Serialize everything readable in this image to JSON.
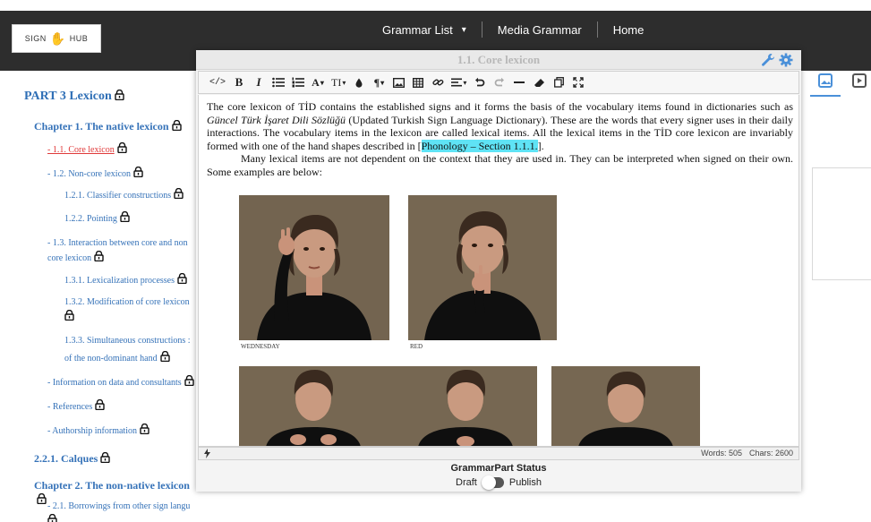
{
  "logo": {
    "left_text": "SIGN",
    "right_text": "HUB"
  },
  "nav": {
    "grammar_list": "Grammar List",
    "dropdown_caret": "▾",
    "media_grammar": "Media Grammar",
    "home": "Home"
  },
  "sidebar": {
    "part": "PART 3 Lexicon",
    "chapter1": "Chapter 1. The native lexicon",
    "item_1_1": "- 1.1. Core lexicon",
    "item_1_2": "- 1.2. Non-core lexicon",
    "item_1_2_1": "1.2.1. Classifier constructions",
    "item_1_2_2": "1.2.2. Pointing",
    "item_1_3_a": "- 1.3. Interaction between core and non",
    "item_1_3_b": "core lexicon",
    "item_1_3_1": "1.3.1. Lexicalization processes",
    "item_1_3_2": "1.3.2. Modification of core lexicon",
    "item_1_3_3_a": "1.3.3. Simultaneous constructions :",
    "item_1_3_3_b": "of the non-dominant hand",
    "info": "- Information on data and consultants",
    "references": "- References",
    "authorship": "- Authorship information",
    "calques": "2.2.1. Calques",
    "chapter2": "Chapter 2. The non-native lexicon",
    "borrowings": "- 2.1. Borrowings from other sign langu"
  },
  "modal": {
    "title": "1.1. Core lexicon",
    "toolbar": {
      "code": "</>",
      "bold": "B",
      "italic": "I",
      "font": "A",
      "size": "TI",
      "para": "¶"
    },
    "paragraph1_a": "The core lexicon of TİD contains the established signs and it forms the basis of the vocabulary items found in dictionaries such as ",
    "paragraph1_italic": "Güncel Türk İşaret Dili Sözlüğü",
    "paragraph1_b": " (Updated Turkish Sign Language Dictionary). These are the words that every signer uses in their daily interactions. The vocabulary items in the lexicon are called lexical items. All the lexical items in the TİD core lexicon are invariably formed with one of the hand shapes described in [",
    "paragraph1_link": "Phonology – Section 1.1.1.",
    "paragraph1_c": "].",
    "paragraph2": "Many lexical items are not dependent on the context that they are used in. They can be interpreted when signed on their own. Some examples are below:",
    "caption1": "WEDNESDAY",
    "caption2": "RED",
    "words": "Words: 505",
    "chars": "Chars: 2600",
    "status_title": "GrammarPart Status",
    "draft": "Draft",
    "publish": "Publish"
  },
  "colors": {
    "nav_bg": "#2d2d2d",
    "link_blue": "#3572b8",
    "active_red": "#e03a3a",
    "highlight": "#5fe3f5",
    "tool_blue": "#4a90d9"
  }
}
